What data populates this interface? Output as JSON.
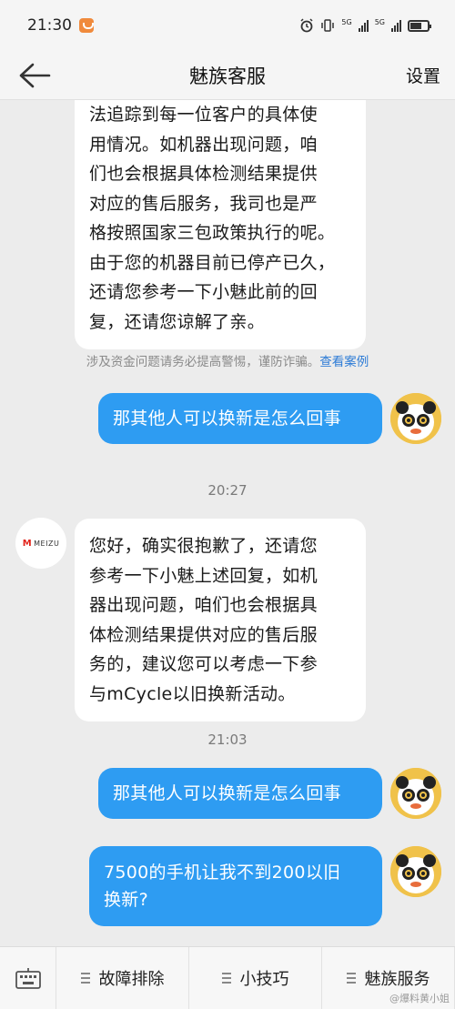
{
  "status_bar": {
    "time": "21:30",
    "network_1": "5G",
    "network_2": "5G"
  },
  "header": {
    "title": "魅族客服",
    "settings_label": "设置"
  },
  "messages": {
    "m1_lines": [
      "法追踪到每一位客户的具体使",
      "用情况。如机器出现问题，咱",
      "们也会根据具体检测结果提供",
      "对应的售后服务，我司也是严",
      "格按照国家三包政策执行的呢。",
      "由于您的机器目前已停产已久，",
      "还请您参考一下小魅此前的回",
      "复，还请您谅解了亲。"
    ],
    "notice_text": "涉及资金问题请务必提高警惕，谨防诈骗。",
    "notice_link": "查看案例",
    "m2": "那其他人可以换新是怎么回事",
    "time_1": "20:27",
    "m3_lines": [
      "您好，确实很抱歉了，还请您",
      "参考一下小魅上述回复，如机",
      "器出现问题，咱们也会根据具",
      "体检测结果提供对应的售后服",
      "务的，建议您可以考虑一下参",
      "与mCycle以旧换新活动。"
    ],
    "time_2": "21:03",
    "m4": "那其他人可以换新是怎么回事",
    "m5_lines": [
      "7500的手机让我不到200以旧",
      "换新?"
    ]
  },
  "meizu_logo_text": "MEIZU",
  "bottom_bar": {
    "items": [
      "故障排除",
      "小技巧",
      "魅族服务"
    ]
  },
  "watermark": "@爆料黄小姐",
  "colors": {
    "user_bubble": "#2e9cf2",
    "agent_bubble": "#ffffff",
    "background": "#ececec",
    "link": "#2e7cd6"
  }
}
